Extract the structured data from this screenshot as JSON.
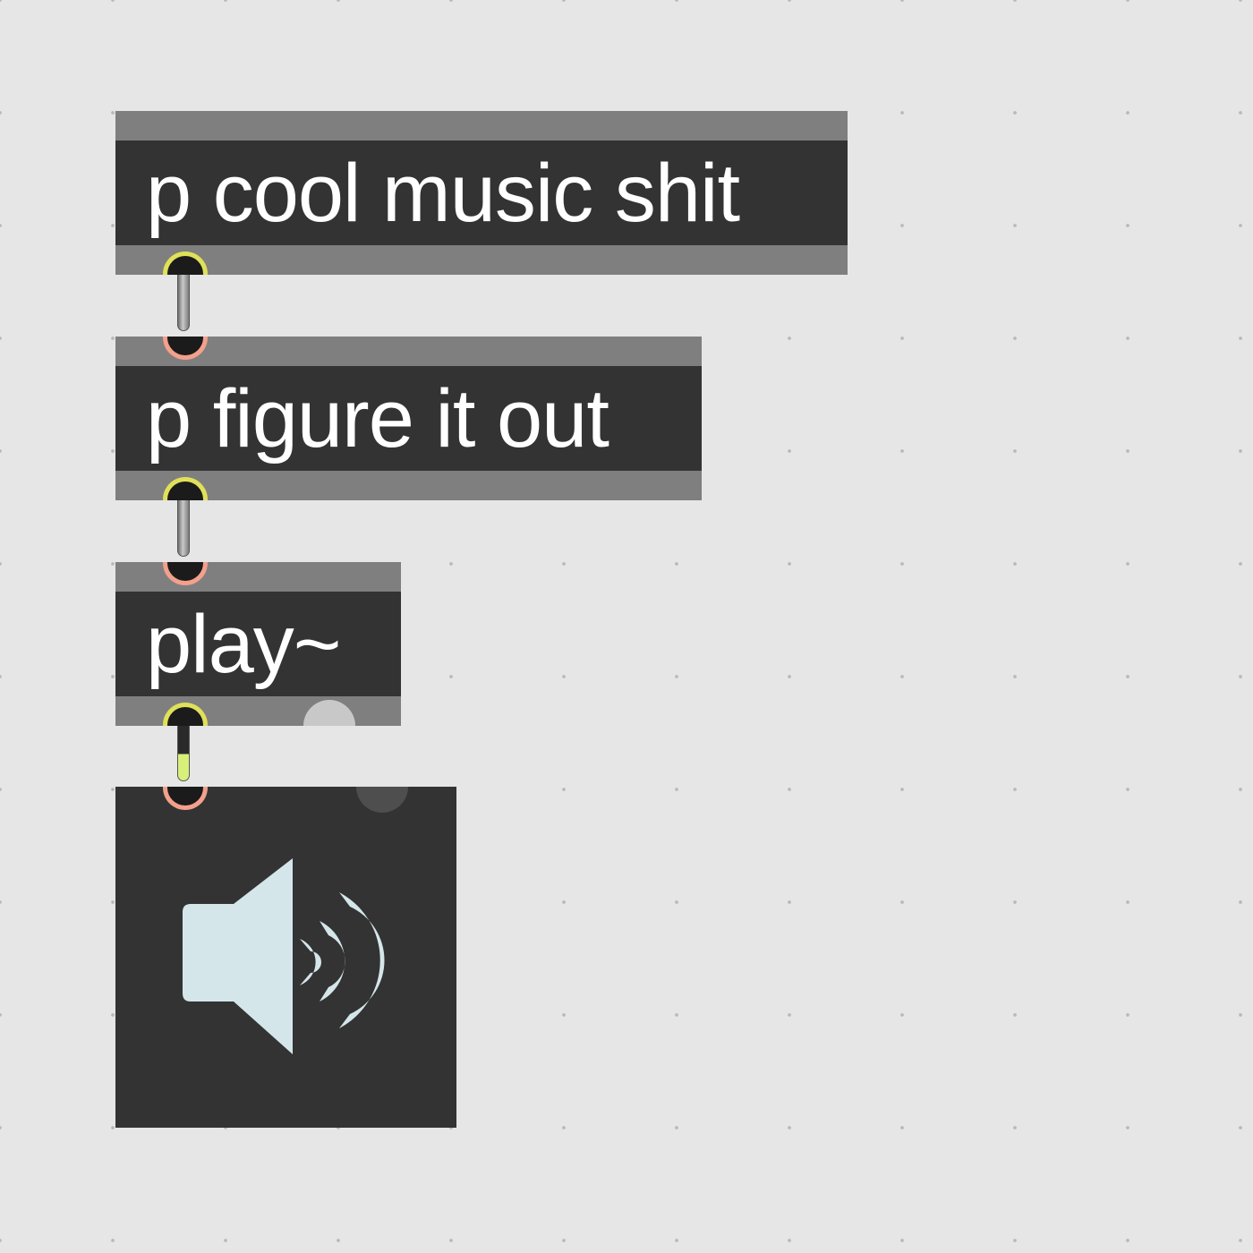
{
  "patcher": {
    "objects": [
      {
        "id": "obj1",
        "text": "p cool music shit"
      },
      {
        "id": "obj2",
        "text": "p figure it out"
      },
      {
        "id": "obj3",
        "text": "play~"
      }
    ],
    "dac": {
      "icon": "speaker-icon"
    }
  },
  "colors": {
    "background": "#e6e6e6",
    "object_body": "#333333",
    "object_border": "#7f7f7f",
    "outlet": "#e0e05a",
    "inlet": "#f3a08c",
    "speaker": "#d4e6ea"
  }
}
